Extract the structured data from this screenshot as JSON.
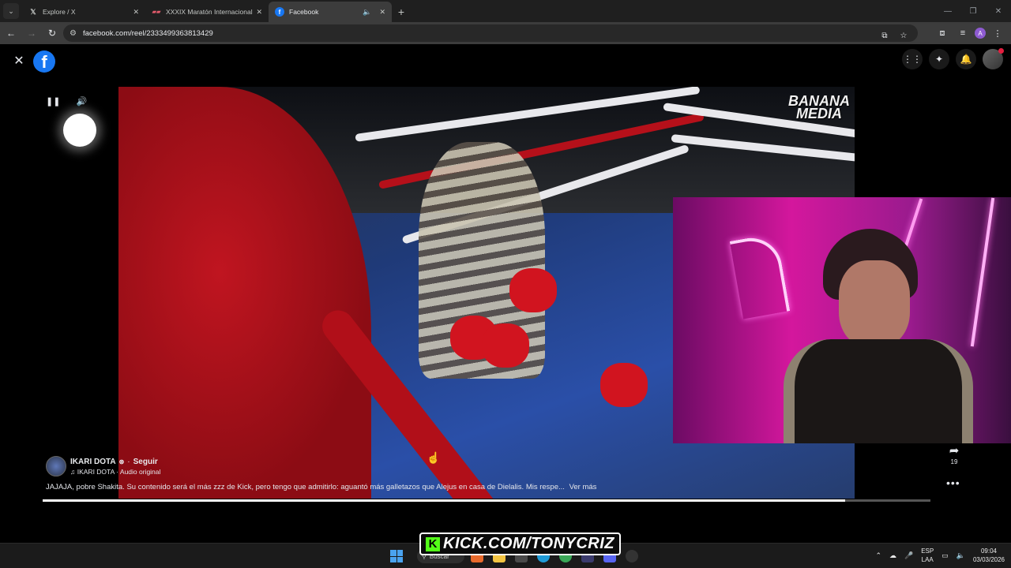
{
  "browser": {
    "tabs": [
      {
        "title": "Explore / X",
        "favicon": "x-logo"
      },
      {
        "title": "XXXIX Maratón Internacional V",
        "favicon": "marathon-logo"
      },
      {
        "title": "Facebook",
        "favicon": "facebook-logo",
        "active": true,
        "audio": true
      }
    ],
    "new_tab": "+",
    "url": "facebook.com/reel/2333499363813429"
  },
  "fb": {
    "logo": "f",
    "close": "✕"
  },
  "video": {
    "watermark_line1": "BANANA",
    "watermark_line2": "MEDIA"
  },
  "reel": {
    "author": "IKARI DOTA",
    "follow": "Seguir",
    "audio_label": "♫ IKARI DOTA · Audio original",
    "caption": "JAJAJA, pobre Shakita. Su contenido será el más zzz de Kick, pero tengo que admitirlo: aguantó más galletazos que Alejus en casa de Dielalis. Mis respe...",
    "see_more": "Ver más",
    "share_count": "19",
    "progress": 0.904
  },
  "overlay": {
    "kick_k": "K",
    "kick_text": "KICK.COM/TONYCRIZ"
  },
  "taskbar": {
    "search_placeholder": "Buscar",
    "lang_line1": "ESP",
    "lang_line2": "LAA",
    "time": "09:04",
    "date": "03/03/2026"
  },
  "colors": {
    "facebook_blue": "#1877f2",
    "kick_green": "#53fc18"
  }
}
